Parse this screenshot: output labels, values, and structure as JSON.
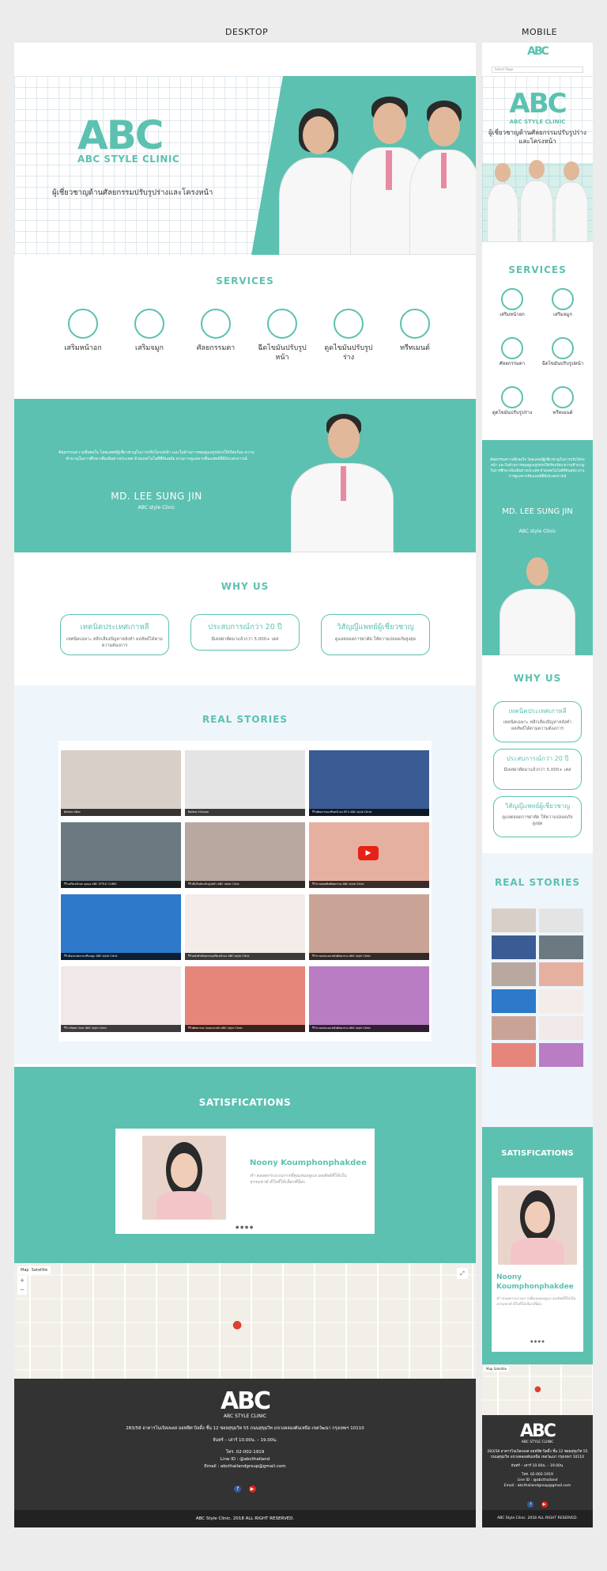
{
  "labels": {
    "desktop": "DESKTOP",
    "mobile": "MOBILE"
  },
  "brand": {
    "logo_letters": "ABC",
    "logo_name": "ABC STYLE CLINIC",
    "tagline": "ผู้เชี่ยวชาญด้านศัลยกรรมปรับรูปร่างและโครงหน้า",
    "accent": "#5cc1b0"
  },
  "mobile_nav": {
    "select_placeholder": "Select Page"
  },
  "services": {
    "title": "SERVICES",
    "items": [
      {
        "label": "เสริมหน้าอก",
        "icon": "breast-icon"
      },
      {
        "label": "เสริมจมูก",
        "icon": "nose-icon"
      },
      {
        "label": "ศัลยกรรมตา",
        "icon": "eye-icon"
      },
      {
        "label": "ฉีดไขมันปรับรูปหน้า",
        "icon": "face-icon"
      },
      {
        "label": "ดูดไขมันปรับรูปร่าง",
        "icon": "body-icon"
      },
      {
        "label": "ทรีทเมนต์",
        "icon": "treatment-icon"
      }
    ]
  },
  "doctor": {
    "intro": "ศัลยกรรมความพึงพอใจ โดยแพทย์ผู้เชี่ยวชาญในการปรับโครงหน้า และในด้านการพยุงดูแลรูปทรงให้เรียบร้อย ความชำนาญในการศึกษาเพิ่มเติมต่างประเทศ ด้วยเทคโนโลยีที่ทันสมัย ผ่านการดูแลจากทีมแพทย์ที่มีประสบการณ์",
    "name": "MD. LEE SUNG JIN",
    "clinic": "ABC style Clinic"
  },
  "why": {
    "title": "WHY US",
    "items": [
      {
        "heading": "เทคนิคประเทศเกาหลี",
        "text": "เทคนิคเฉพาะ หลีกเลี่ยงปัญหาหลังทำ ผลลัพธ์ได้ตามความต้องการ"
      },
      {
        "heading": "ประสบการณ์กว่า 20 ปี",
        "text": "มีเคสผ่าตัดมาแล้วกว่า 5,000+ เคส"
      },
      {
        "heading": "วิสัญญีแพทย์ผู้เชี่ยวชาญ",
        "text": "ดูแลตลอดการผ่าตัด ให้ความปลอดภัยสูงสุด"
      }
    ]
  },
  "stories": {
    "title": "REAL STORIES",
    "items": [
      {
        "caption": "Before After"
      },
      {
        "caption": "Before Silicone"
      },
      {
        "caption": "รีวิวศัลยกรรมเสริมหน้าอก EP.2 ABC style Clinic"
      },
      {
        "caption": "รีวิวเสริมหน้าอก คุณเอ ABC STYLE CLINIC"
      },
      {
        "caption": "รีวิวฉีดไขมันปรับรูปหน้า ABC style Clinic"
      },
      {
        "caption": "รีวิวรวมเทคนิคศัลยกรรม ABC style Clinic"
      },
      {
        "caption": "รีวิวน้องนนทจากเสริมจมูก ABC style Clinic"
      },
      {
        "caption": "รีวิวหลังทำศัลยกรรมเสริมหน้าอก ABC style Clinic"
      },
      {
        "caption": "รีวิวรวมก่อนและหลังศัลยกรรม ABC style Clinic"
      },
      {
        "caption": "รีวิว Make Over ABC style Clinic"
      },
      {
        "caption": "รีวิวศัลยกรรม ก่อนและหลัง ABC style Clinic"
      },
      {
        "caption": "รีวิวรวมก่อนและหลังศัลยกรรม ABC style Clinic"
      }
    ]
  },
  "satisfactions": {
    "title": "SATISFICATIONS",
    "name": "Noony Koumphonphakdee",
    "quote": "ทำ ตลอดกระบวนการที่คุณหมอดูแล ผลลัพธ์ที่ได้เป็นธรรมชาติ ดีใจที่ได้เลือกที่นี่ค่ะ"
  },
  "map": {
    "tab_map": "Map",
    "tab_satellite": "Satellite"
  },
  "footer": {
    "address": "283/58 อาคารโนเบิลเพลส ออฟฟิศ บิลดิ้ง ชั้น 12 ซอยสุขุมวิท 55 ถนนสุขุมวิท แขวงคลองตันเหนือ เขตวัฒนา กรุงเทพฯ 10110",
    "hours": "จันทร์ – เสาร์ 10.00น. – 19.00น.",
    "tel": "โทร. 02-002-1919",
    "line": "Line ID : @abcthailand",
    "email": "Email : abcthailandgroup@gmail.com",
    "copyright": "ABC Style Clinic. 2018 ALL RIGHT RESERVED.",
    "facebook": "f",
    "youtube": "▶"
  }
}
